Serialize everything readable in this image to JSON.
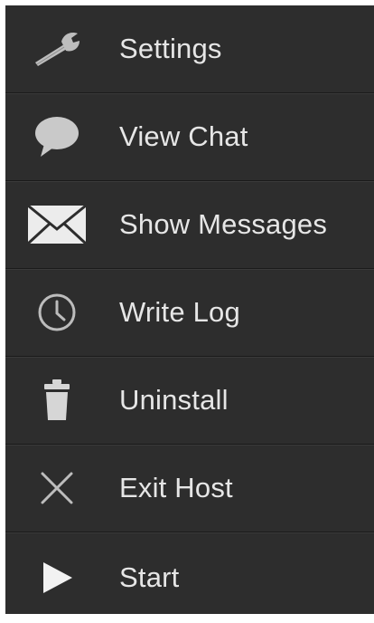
{
  "menu": {
    "items": [
      {
        "label": "Settings",
        "icon": "wrench-icon"
      },
      {
        "label": "View Chat",
        "icon": "chat-bubble-icon"
      },
      {
        "label": "Show Messages",
        "icon": "envelope-icon"
      },
      {
        "label": "Write Log",
        "icon": "clock-icon"
      },
      {
        "label": "Uninstall",
        "icon": "trash-icon"
      },
      {
        "label": "Exit Host",
        "icon": "close-x-icon"
      },
      {
        "label": "Start",
        "icon": "play-icon"
      }
    ]
  },
  "colors": {
    "background": "#2d2d2d",
    "text": "#e6e6e6",
    "icon": "#c8c8c8",
    "divider": "#1a1a1a"
  }
}
